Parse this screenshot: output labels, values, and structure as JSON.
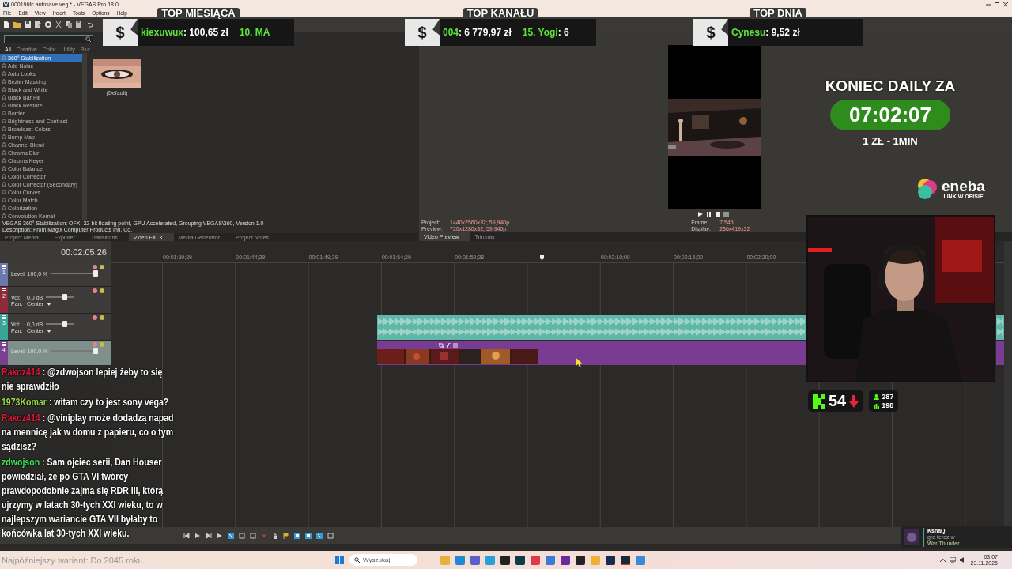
{
  "window": {
    "title": "000196fc.autosave.veg * - VEGAS Pro 18.0"
  },
  "menu": [
    "File",
    "Edit",
    "View",
    "Insert",
    "Tools",
    "Options",
    "Help"
  ],
  "video_fx": {
    "filters": [
      {
        "label": "All",
        "selected": true
      },
      {
        "label": "Creative",
        "selected": false
      },
      {
        "label": "Color",
        "selected": false
      },
      {
        "label": "Utility",
        "selected": false
      },
      {
        "label": "Blur",
        "selected": false
      }
    ],
    "effects": [
      {
        "label": "360° Stabilization",
        "selected": true
      },
      {
        "label": "Add Noise",
        "selected": false
      },
      {
        "label": "Auto Looks",
        "selected": false
      },
      {
        "label": "Bezier Masking",
        "selected": false
      },
      {
        "label": "Black and White",
        "selected": false
      },
      {
        "label": "Black Bar Fill",
        "selected": false
      },
      {
        "label": "Black Restore",
        "selected": false
      },
      {
        "label": "Border",
        "selected": false
      },
      {
        "label": "Brightness and Contrast",
        "selected": false
      },
      {
        "label": "Broadcast Colors",
        "selected": false
      },
      {
        "label": "Bump Map",
        "selected": false
      },
      {
        "label": "Channel Blend",
        "selected": false
      },
      {
        "label": "Chroma Blur",
        "selected": false
      },
      {
        "label": "Chroma Keyer",
        "selected": false
      },
      {
        "label": "Color Balance",
        "selected": false
      },
      {
        "label": "Color Corrector",
        "selected": false
      },
      {
        "label": "Color Corrector (Secondary)",
        "selected": false
      },
      {
        "label": "Color Curves",
        "selected": false
      },
      {
        "label": "Color Match",
        "selected": false
      },
      {
        "label": "Colorization",
        "selected": false
      },
      {
        "label": "Convolution Kernel",
        "selected": false
      }
    ],
    "preset": "(Default)",
    "info": [
      "VEGAS 360° Stabilization: OFX, 32-bit floating point, GPU Accelerated, Grouping VEGAS\\360, Version 1.0",
      "Description: From Magix Computer Products Intl. Co."
    ]
  },
  "left_tabs": [
    {
      "label": "Project Media",
      "selected": false
    },
    {
      "label": "Explorer",
      "selected": false
    },
    {
      "label": "Transitions",
      "selected": false
    },
    {
      "label": "Video FX",
      "selected": true
    },
    {
      "label": "Media Generator",
      "selected": false
    },
    {
      "label": "Project Notes",
      "selected": false
    }
  ],
  "preview": {
    "stats": [
      {
        "label": "Project:",
        "value": "1440x2560x32; 59,940p"
      },
      {
        "label": "Preview:",
        "value": "720x1280x32; 59,940p"
      }
    ],
    "frame": [
      {
        "label": "Frame:",
        "value": "7 545"
      },
      {
        "label": "Display:",
        "value": "236x419x32"
      }
    ],
    "tabs": [
      {
        "label": "Video Preview",
        "selected": true
      },
      {
        "label": "Trimmer",
        "selected": false
      }
    ]
  },
  "timeline": {
    "time": "00:02:05;26",
    "ruler": [
      "00:01:39;29",
      "00:01:44;29",
      "00:01:49;29",
      "00:01:54;29",
      "00:01:59;28",
      "00:02:10;00",
      "00:02:15;00",
      "00:02:20;00"
    ],
    "tracks": [
      {
        "kind": "video",
        "number": "1",
        "color": "#6b79b0",
        "selected": false,
        "level_label": "Level: 100,0 %",
        "level": 1
      },
      {
        "kind": "audio",
        "number": "2",
        "color": "#8d2b3c",
        "selected": false,
        "vol_label": "Vol:",
        "vol": "0,0 dB",
        "level": 0.7,
        "pan_label": "Pan:",
        "pan": "Center"
      },
      {
        "kind": "audio",
        "number": "3",
        "color": "#3aa596",
        "selected": false,
        "vol_label": "Vol:",
        "vol": "0,0 dB",
        "level": 0.7,
        "pan_label": "Pan:",
        "pan": "Center",
        "clips": [
          {
            "kind": "audio"
          }
        ]
      },
      {
        "kind": "video",
        "number": "4",
        "color": "#7b3f92",
        "selected": true,
        "level_label": "Level: 100,0 %",
        "level": 1,
        "clips": [
          {
            "kind": "video"
          }
        ]
      }
    ]
  },
  "donations": [
    {
      "title": "TOP MIESIĄCA",
      "currency": "$",
      "entries": [
        {
          "name": "kiexuwux",
          "amount": ": 100,65 zł"
        },
        {
          "name": "10. MA"
        }
      ]
    },
    {
      "title": "TOP KANAŁU",
      "currency": "$",
      "entries": [
        {
          "name": "004",
          "amount": ": 6 779,97 zł"
        },
        {
          "name": "15. Yogi",
          "amount": ": 6"
        }
      ]
    },
    {
      "title": "TOP DNIA",
      "currency": "$",
      "entries": [
        {
          "name": "Cynesu",
          "amount": ": 9,52 zł"
        }
      ]
    }
  ],
  "daily_timer": {
    "title": "KONIEC DAILY ZA",
    "time": "07:02:07",
    "rate": "1 ZŁ - 1MIN"
  },
  "sponsor": {
    "name": "eneba",
    "tagline": "LINK W OPISIE"
  },
  "stream_stats": {
    "count": "54",
    "stat_1": "287",
    "stat_2": "198"
  },
  "chat": [
    {
      "user": "Rakoz414",
      "color": "#e3173a",
      "text": ": @zdwojson lepiej żeby to się nie sprawdziło"
    },
    {
      "user": "1973Komar",
      "color": "#9ad84a",
      "text": ": witam czy to jest sony vega?"
    },
    {
      "user": "Rakoz414",
      "color": "#e3173a",
      "text": ": @viniplay może dodadzą napad na mennicę jak w domu z papieru, co o tym sądzisz?"
    },
    {
      "user": "zdwojson",
      "color": "#3ee05a",
      "text": ": Sam ojciec serii, Dan Houser powiedział, że po GTA VI twórcy prawdopodobnie zajmą się RDR III, którą ujrzymy w latach 30-tych XXI wieku, to w najlepszym wariancie GTA VII byłaby to końcówka lat 30-tych XXI wieku."
    }
  ],
  "caption": "Najpóźniejszy wariant: Do 2045 roku.",
  "notification": {
    "user": "KshaQ",
    "status": "gra teraz w",
    "game": "War Thunder"
  },
  "taskbar": {
    "search_placeholder": "Wyszukaj",
    "time": "03:07",
    "date": "23.11.2025"
  }
}
